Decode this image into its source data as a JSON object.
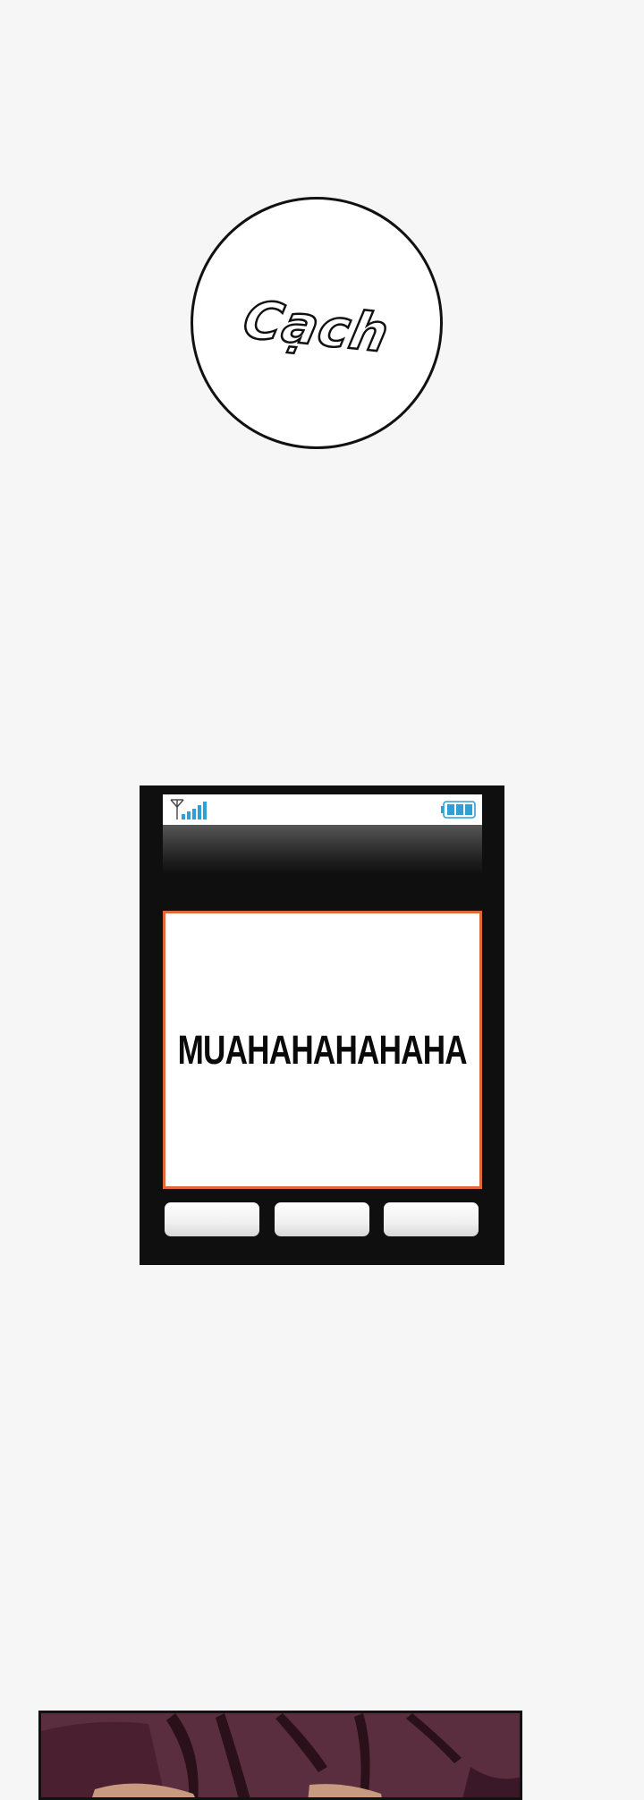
{
  "sfx": {
    "text": "Cạch"
  },
  "phone": {
    "status_bar": {
      "signal_icon": "signal-bars-icon",
      "battery_icon": "battery-full-icon"
    },
    "message": "MUAHAHAHAHAHA",
    "soft_keys": [
      "",
      "",
      ""
    ],
    "colors": {
      "frame": "#0f0f0f",
      "message_border": "#e2683c",
      "signal": "#2f9fd6",
      "battery": "#2f9fd6"
    }
  },
  "panel": {
    "colors": {
      "background": "#5a2e3e",
      "hair": "#2a1018",
      "skin": "#c89a80"
    }
  }
}
